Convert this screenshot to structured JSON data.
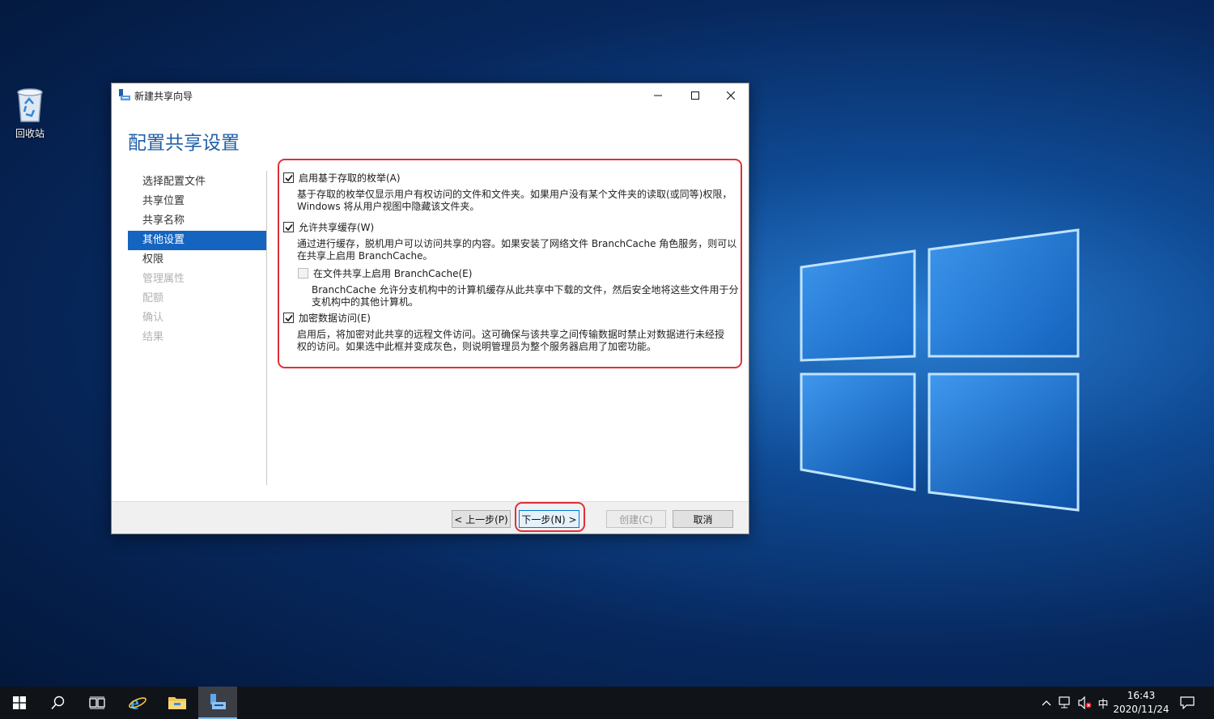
{
  "desktop": {
    "recycle_bin_label": "回收站",
    "logo_color": "#63b8ff"
  },
  "window": {
    "title": "新建共享向导",
    "heading": "配置共享设置",
    "accent_color": "#1e5fa8"
  },
  "nav": {
    "items": [
      {
        "label": "选择配置文件",
        "state": "normal"
      },
      {
        "label": "共享位置",
        "state": "normal"
      },
      {
        "label": "共享名称",
        "state": "normal"
      },
      {
        "label": "其他设置",
        "state": "active"
      },
      {
        "label": "权限",
        "state": "normal"
      },
      {
        "label": "管理属性",
        "state": "disabled"
      },
      {
        "label": "配额",
        "state": "disabled"
      },
      {
        "label": "确认",
        "state": "disabled"
      },
      {
        "label": "结果",
        "state": "disabled"
      }
    ]
  },
  "options": {
    "abe": {
      "label": "启用基于存取的枚举(A)",
      "checked": true,
      "desc_line1": "基于存取的枚举仅显示用户有权访问的文件和文件夹。如果用户没有某个文件夹的读取(或同等)权限，",
      "desc_line2": "Windows 将从用户视图中隐藏该文件夹。"
    },
    "cache": {
      "label": "允许共享缓存(W)",
      "checked": true,
      "desc_line1": "通过进行缓存，脱机用户可以访问共享的内容。如果安装了网络文件 BranchCache 角色服务，则可以",
      "desc_line2": "在共享上启用 BranchCache。"
    },
    "branchcache": {
      "label": "在文件共享上启用 BranchCache(E)",
      "checked": false,
      "disabled": true,
      "desc_line1": "BranchCache 允许分支机构中的计算机缓存从此共享中下载的文件，然后安全地将这些文件用于分",
      "desc_line2": "支机构中的其他计算机。"
    },
    "encrypt": {
      "label": "加密数据访问(E)",
      "checked": true,
      "desc_line1": "启用后，将加密对此共享的远程文件访问。这可确保与该共享之间传输数据时禁止对数据进行未经授",
      "desc_line2": "权的访问。如果选中此框并变成灰色，则说明管理员为整个服务器启用了加密功能。"
    }
  },
  "buttons": {
    "prev": "< 上一步(P)",
    "next": "下一步(N) >",
    "create": "创建(C)",
    "cancel": "取消"
  },
  "highlight_color": "#e0303a",
  "taskbar": {
    "input_method": "中",
    "time": "16:43",
    "date": "2020/11/24"
  }
}
